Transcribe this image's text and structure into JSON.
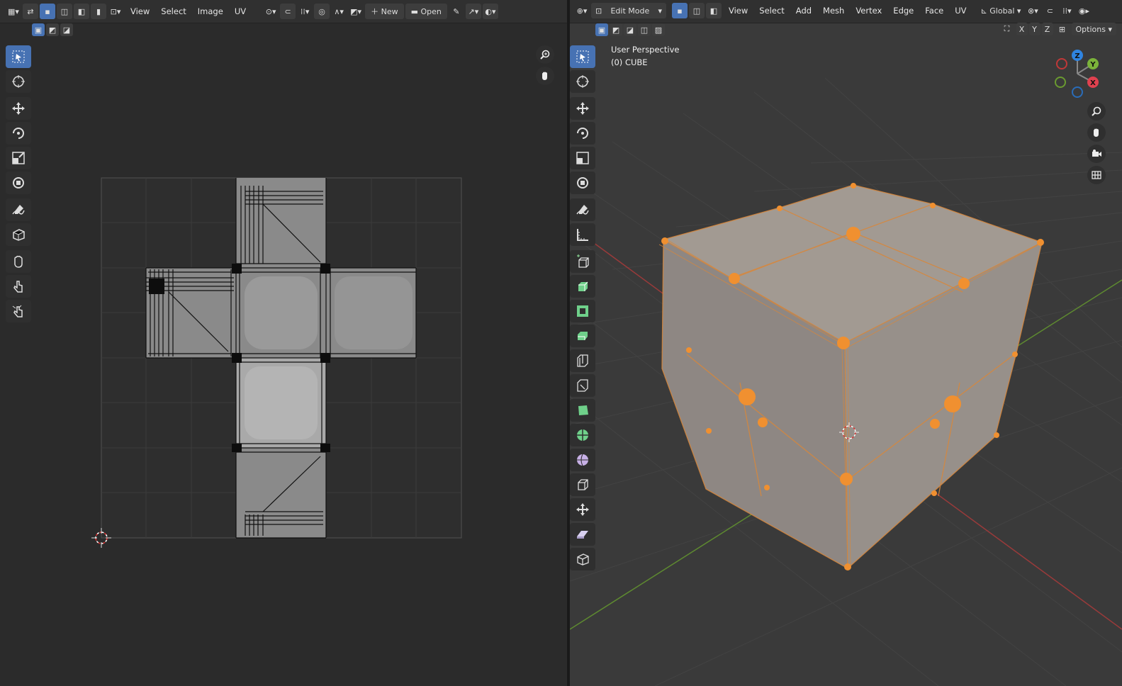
{
  "uv_editor": {
    "menus": [
      "View",
      "Select",
      "Image",
      "UV"
    ],
    "new_label": "New",
    "open_label": "Open"
  },
  "view3d": {
    "mode_label": "Edit Mode",
    "menus": [
      "View",
      "Select",
      "Add",
      "Mesh",
      "Vertex",
      "Edge",
      "Face",
      "UV"
    ],
    "orientation_label": "Global",
    "axes": [
      "X",
      "Y",
      "Z"
    ],
    "options_label": "Options",
    "perspective_label": "User Perspective",
    "object_label": "(0) CUBE",
    "gizmo_labels": {
      "x": "X",
      "y": "Y",
      "z": "Z"
    }
  },
  "colors": {
    "accent": "#4772b3",
    "selection": "#f08c28",
    "grid_x": "#a33a3a",
    "grid_y": "#6ea43a"
  }
}
